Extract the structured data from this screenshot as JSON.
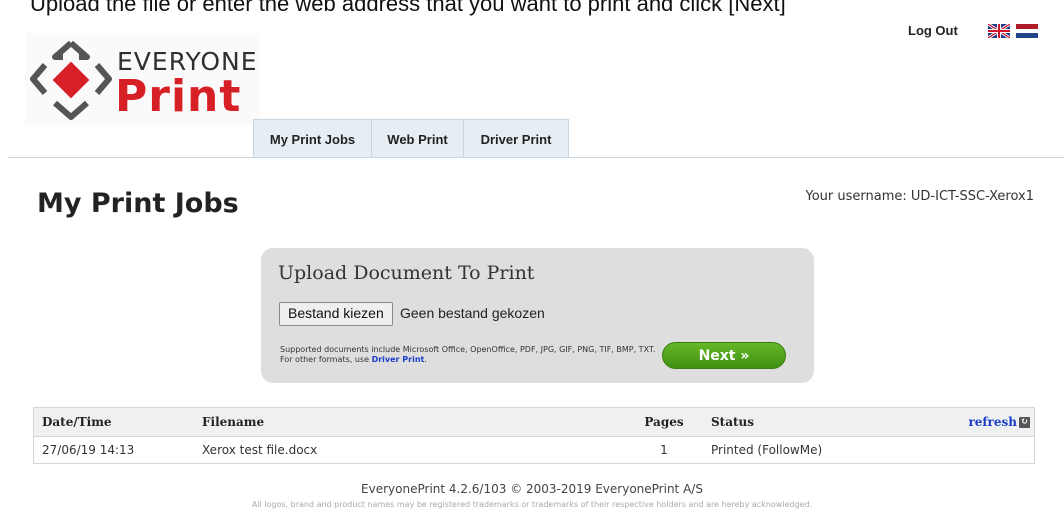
{
  "instruction": "Upload the file or enter the web address that you want to print and click [Next]",
  "logo": {
    "line1": "EVERYONE",
    "line2": "Print"
  },
  "header": {
    "logout_label": "Log Out",
    "languages": [
      "english-flag",
      "dutch-flag"
    ]
  },
  "tabs": [
    {
      "label": "My Print Jobs",
      "active": true
    },
    {
      "label": "Web Print",
      "active": false
    },
    {
      "label": "Driver Print",
      "active": false
    }
  ],
  "page": {
    "title": "My Print Jobs",
    "username_text": "Your username: UD-ICT-SSC-Xerox1"
  },
  "upload": {
    "title": "Upload Document To Print",
    "choose_file_label": "Bestand kiezen",
    "no_file_text": "Geen bestand gekozen",
    "supported_text": "Supported documents include Microsoft Office, OpenOffice, PDF, JPG, GIF, PNG, TIF, BMP, TXT. For other formats, use",
    "driver_print_link": "Driver Print",
    "supported_suffix": ".",
    "next_label": "Next »"
  },
  "jobs_table": {
    "headers": {
      "date": "Date/Time",
      "filename": "Filename",
      "pages": "Pages",
      "status": "Status",
      "refresh": "refresh"
    },
    "rows": [
      {
        "date": "27/06/19 14:13",
        "filename": "Xerox test file.docx",
        "pages": "1",
        "status": "Printed (FollowMe)"
      }
    ]
  },
  "footer": {
    "version": "EveryonePrint 4.2.6/103 © 2003-2019 EveryonePrint A/S",
    "disclaimer": "All logos, brand and product names may be registered trademarks or trademarks of their respective holders and are hereby acknowledged."
  },
  "colors": {
    "brand_red": "#d71f26",
    "next_green": "#4fa51b",
    "link_blue": "#1a3cc8",
    "tab_bg": "#e6eef3"
  }
}
